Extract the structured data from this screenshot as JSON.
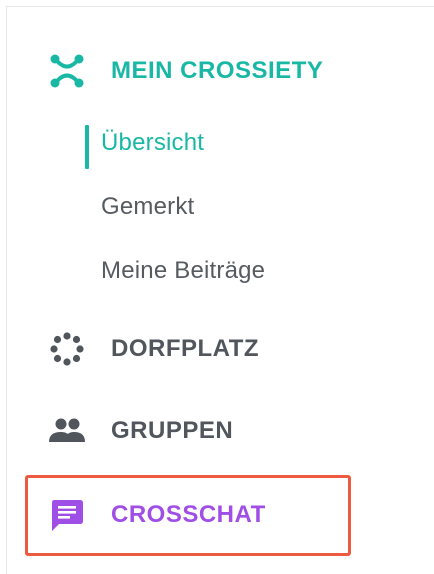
{
  "colors": {
    "accent_teal": "#19b8a5",
    "accent_purple": "#a04fe6",
    "text_gray": "#555b61",
    "highlight_red": "#ec5a3f"
  },
  "nav": {
    "mein_crossiety": {
      "label": "MEIN CROSSIETY",
      "icon": "crossiety-logo-icon",
      "active": true,
      "sub_items": [
        {
          "label": "Übersicht",
          "active": true
        },
        {
          "label": "Gemerkt",
          "active": false
        },
        {
          "label": "Meine Beiträge",
          "active": false
        }
      ]
    },
    "dorfplatz": {
      "label": "DORFPLATZ",
      "icon": "dots-circle-icon"
    },
    "gruppen": {
      "label": "GRUPPEN",
      "icon": "group-icon"
    },
    "crosschat": {
      "label": "CROSSCHAT",
      "icon": "chat-bubble-icon",
      "highlighted": true
    }
  }
}
